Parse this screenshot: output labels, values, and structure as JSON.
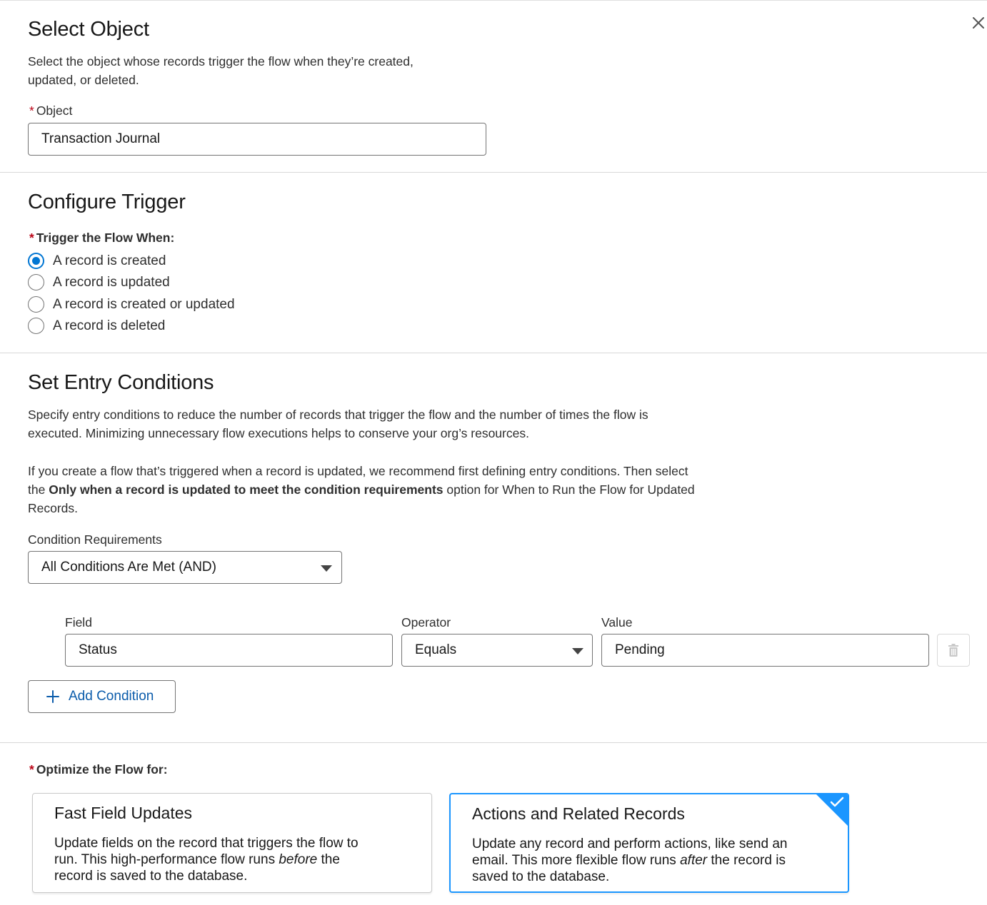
{
  "close_icon": "close-icon",
  "select_object": {
    "title": "Select Object",
    "help_line1": "Select the object whose records trigger the flow when they’re created,",
    "help_line2": "updated, or deleted.",
    "object_label": "Object",
    "object_value": "Transaction Journal"
  },
  "configure_trigger": {
    "title": "Configure Trigger",
    "label": "Trigger the Flow When:",
    "options": [
      {
        "label": "A record is created",
        "selected": true
      },
      {
        "label": "A record is updated",
        "selected": false
      },
      {
        "label": "A record is created or updated",
        "selected": false
      },
      {
        "label": "A record is deleted",
        "selected": false
      }
    ]
  },
  "entry_conditions": {
    "title": "Set Entry Conditions",
    "help_p1_line1": "Specify entry conditions to reduce the number of records that trigger the flow and the number of times the flow is",
    "help_p1_line2": "executed. Minimizing unnecessary flow executions helps to conserve your org’s resources.",
    "help_p2_line1": "If you create a flow that’s triggered when a record is updated, we recommend first defining entry conditions. Then select",
    "help_p2_line2_pre": "the ",
    "help_p2_line2_bold": "Only when a record is updated to meet the condition requirements",
    "help_p2_line2_post": " option for When to Run the Flow for Updated",
    "help_p2_line3": "Records.",
    "condition_req_label": "Condition Requirements",
    "condition_req_value": "All Conditions Are Met (AND)",
    "field_label": "Field",
    "operator_label": "Operator",
    "value_label": "Value",
    "condition": {
      "field": "Status",
      "operator": "Equals",
      "value": "Pending"
    },
    "add_condition_label": "Add Condition"
  },
  "optimize": {
    "label": "Optimize the Flow for:",
    "cards": [
      {
        "title": "Fast Field Updates",
        "desc_line1": "Update fields on the record that triggers the flow to",
        "desc_line2_pre": "run. This high-performance flow runs ",
        "desc_line2_em": "before",
        "desc_line2_post": " the",
        "desc_line3": "record is saved to the database.",
        "selected": false
      },
      {
        "title": "Actions and Related Records",
        "desc_line1": "Update any record and perform actions, like send an",
        "desc_line2_pre": "email. This more flexible flow runs ",
        "desc_line2_em": "after",
        "desc_line2_post": " the record is",
        "desc_line3": "saved to the database.",
        "selected": true
      }
    ]
  },
  "colors": {
    "brand_blue": "#0176d3",
    "selected_border": "#1b96ff",
    "required_red": "#ba0517",
    "link_blue": "#0b5cab"
  }
}
